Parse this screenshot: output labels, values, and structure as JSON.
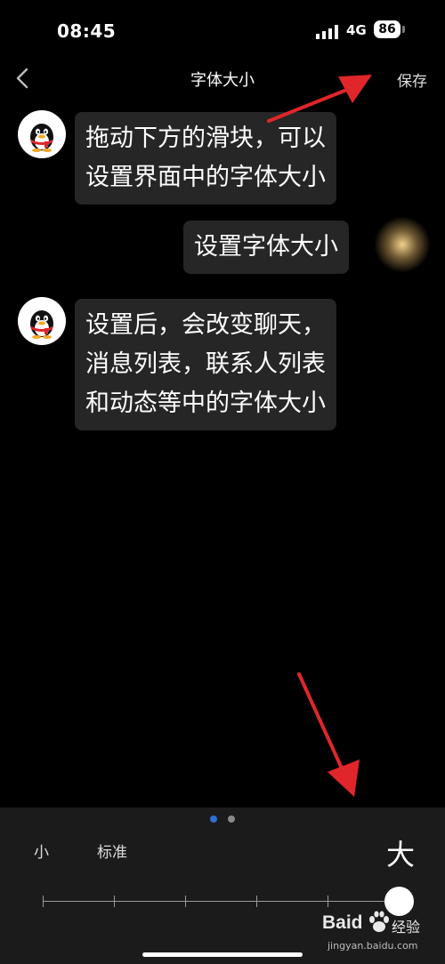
{
  "status_bar": {
    "time": "08:45",
    "network": "4G",
    "battery": "86"
  },
  "nav": {
    "title": "字体大小",
    "save_label": "保存"
  },
  "messages": [
    {
      "side": "left",
      "lines": [
        "拖动下方的滑块，可以",
        "设置界面中的字体大小"
      ]
    },
    {
      "side": "right",
      "lines": [
        "设置字体大小"
      ]
    },
    {
      "side": "left",
      "lines": [
        "设置后，会改变聊天，",
        "消息列表，联系人列表",
        "和动态等中的字体大小"
      ]
    }
  ],
  "font_size_control": {
    "labels": {
      "small": "小",
      "standard": "标准",
      "large": "大"
    },
    "levels": 6,
    "selected_level": 6,
    "page_indicator": {
      "pages": 2,
      "current": 1
    }
  },
  "watermark": {
    "brand": "Baid",
    "suffix": "经验",
    "url": "jingyan.baidu.com"
  },
  "colors": {
    "background": "#000000",
    "bubble": "#262626",
    "panel": "#1b1b1b",
    "accent": "#2f6fd6",
    "annotation_arrow": "#e0262b"
  }
}
